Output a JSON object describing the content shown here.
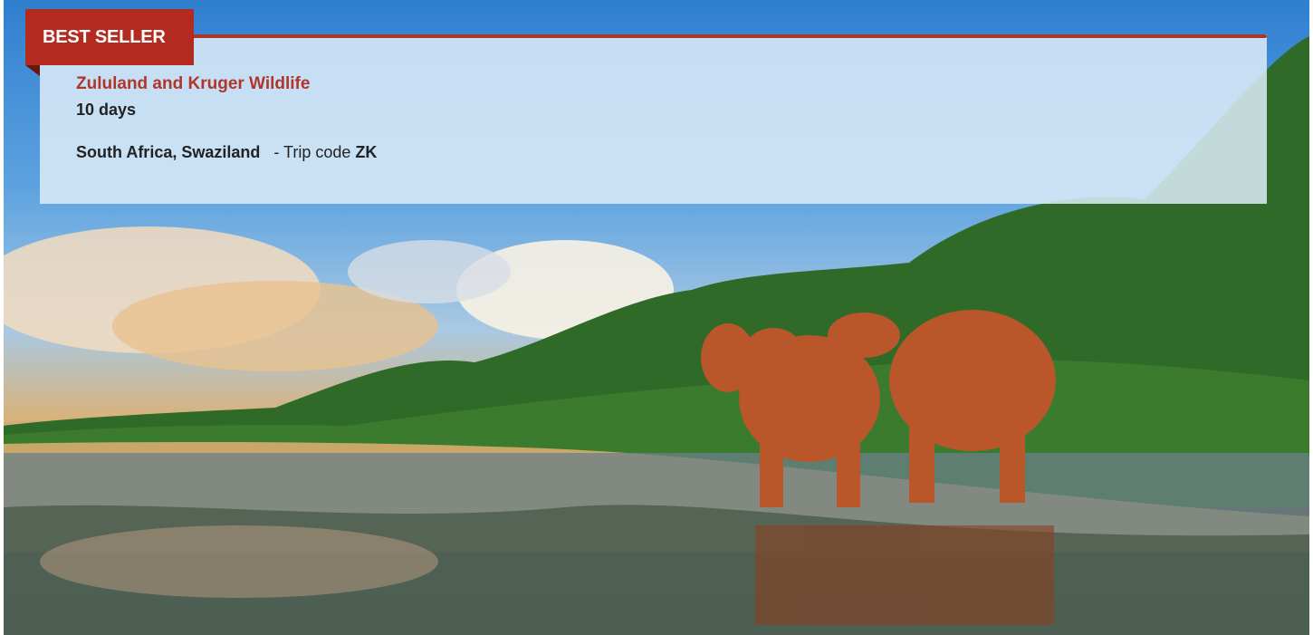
{
  "badge": {
    "label": "BEST SELLER"
  },
  "trip": {
    "title": "Zululand and Kruger Wildlife",
    "duration": "10 days",
    "countries": "South Africa, Swaziland",
    "code_prefix": " - Trip code ",
    "code": "ZK"
  },
  "colors": {
    "accent": "#b32a20",
    "title": "#b0362a",
    "text": "#222222",
    "banner_bg": "#dcecf8"
  },
  "hero": {
    "image_subject": "elephants-at-waterhole",
    "icon": "photo-icon"
  }
}
